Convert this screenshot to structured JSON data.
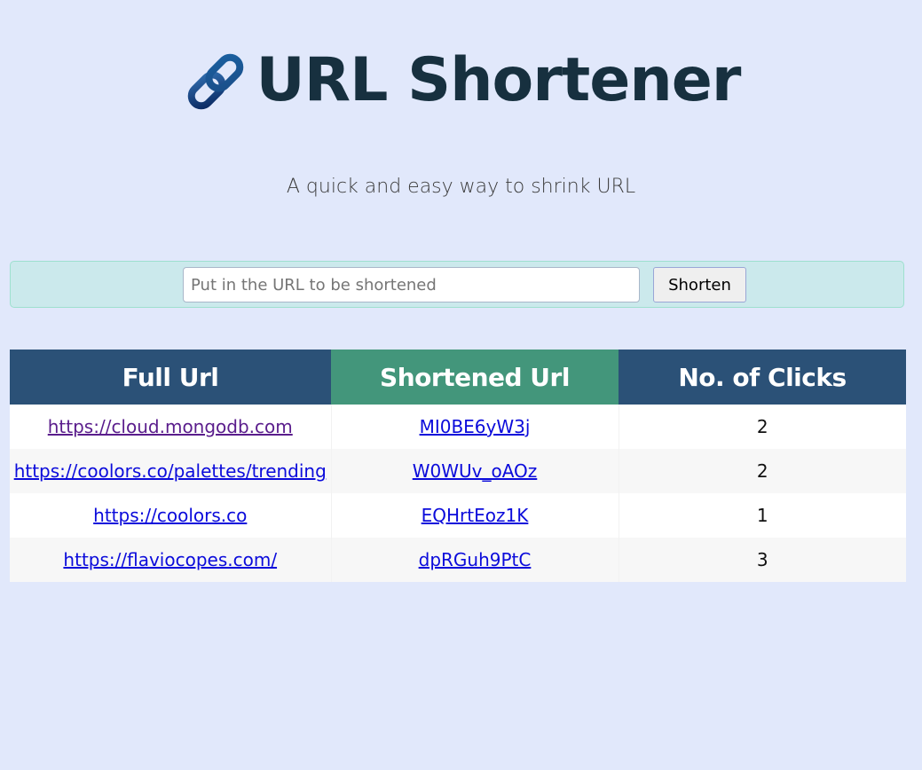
{
  "header": {
    "title": "URL Shortener",
    "icon": "link-icon",
    "subtitle": "A quick and easy way to shrink URL"
  },
  "form": {
    "input_value": "",
    "input_placeholder": "Put in the URL to be shortened",
    "button_label": "Shorten"
  },
  "table": {
    "headers": [
      "Full Url",
      "Shortened Url",
      "No. of Clicks"
    ],
    "rows": [
      {
        "full": "https://cloud.mongodb.com",
        "short": "MI0BE6yW3j",
        "clicks": "2",
        "visited": true
      },
      {
        "full": "https://coolors.co/palettes/trending",
        "short": "W0WUv_oAOz",
        "clicks": "2",
        "visited": false
      },
      {
        "full": "https://coolors.co",
        "short": "EQHrtEoz1K",
        "clicks": "1",
        "visited": false
      },
      {
        "full": "https://flaviocopes.com/",
        "short": "dpRGuh9PtC",
        "clicks": "3",
        "visited": false
      }
    ]
  },
  "colors": {
    "background": "#e1e8fb",
    "title": "#17303f",
    "form_bar": "#cbe9ec",
    "header_blue": "#2b5177",
    "header_green": "#43967b",
    "link": "#0b0bdb",
    "link_visited": "#5a1d8c"
  }
}
